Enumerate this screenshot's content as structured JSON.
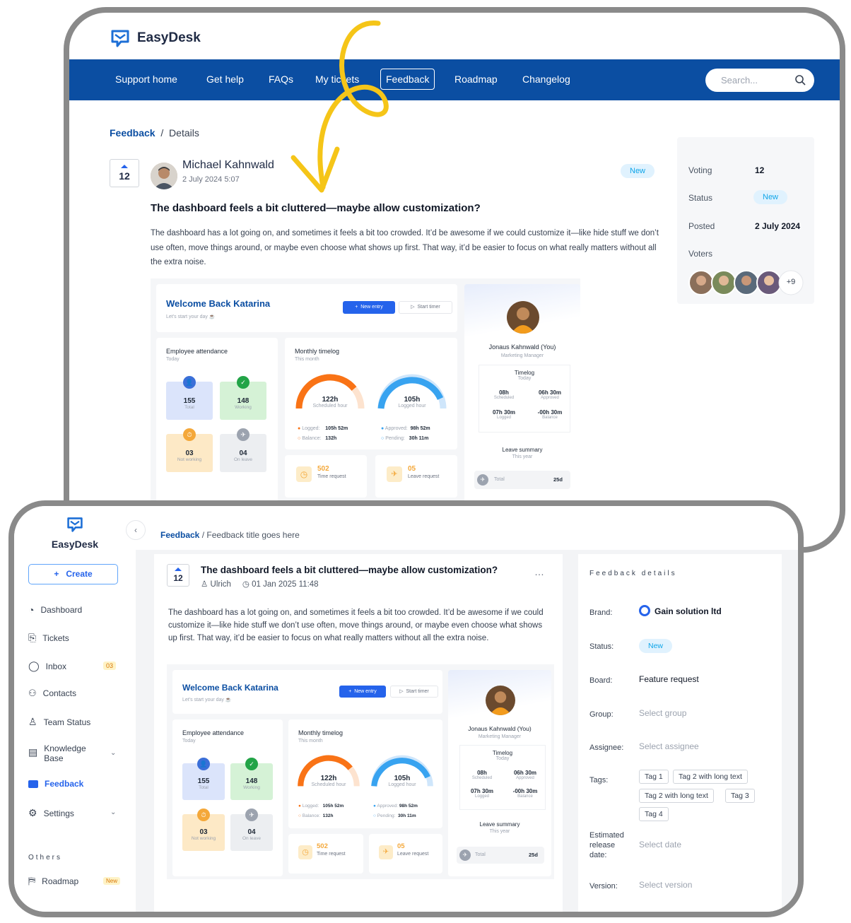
{
  "back": {
    "app_name": "EasyDesk",
    "nav": [
      "Support home",
      "Get help",
      "FAQs",
      "My tickets",
      "Feedback",
      "Roadmap",
      "Changelog"
    ],
    "search_placeholder": "Search...",
    "breadcrumb": {
      "link": "Feedback",
      "sep": "/",
      "current": "Details"
    },
    "votes": "12",
    "author": "Michael Kahnwald",
    "date": "2 July 2024 5:07",
    "status_badge": "New",
    "title": "The dashboard feels a bit cluttered—maybe allow customization?",
    "body": "The dashboard has a lot going on, and sometimes it feels a bit too crowded. It’d be awesome if we could customize it—like hide stuff we don’t use often, move things around, or maybe even choose what shows up first. That way, it’d be easier to focus on what really matters without all the extra noise.",
    "side": {
      "voting_label": "Voting",
      "voting_value": "12",
      "status_label": "Status",
      "status_value": "New",
      "posted_label": "Posted",
      "posted_value": "2 July 2024",
      "voters_label": "Voters",
      "voters_more": "+9"
    }
  },
  "dashboard": {
    "welcome": "Welcome Back Katarina",
    "welcome_sub": "Let's start your day",
    "new_entry": "New entry",
    "start_timer": "Start timer",
    "attendance_title": "Employee attendance",
    "attendance_sub": "Today",
    "tiles": [
      {
        "num": "155",
        "sub": "Total"
      },
      {
        "num": "148",
        "sub": "Working"
      },
      {
        "num": "03",
        "sub": "Not working"
      },
      {
        "num": "04",
        "sub": "On leave"
      }
    ],
    "timelog_title": "Monthly timelog",
    "timelog_sub": "This month",
    "gauge1": {
      "value": "122h",
      "sub": "Scheduled hour"
    },
    "gauge2": {
      "value": "105h",
      "sub": "Logged hour"
    },
    "legend": {
      "logged_label": "Logged:",
      "logged_value": "105h 52m",
      "balance_label": "Balance:",
      "balance_value": "132h",
      "approved_label": "Approved:",
      "approved_value": "98h 52m",
      "pending_label": "Pending:",
      "pending_value": "30h 11m"
    },
    "stat1": {
      "num": "502",
      "sub": "Time request"
    },
    "stat2": {
      "num": "05",
      "sub": "Leave request"
    },
    "profile": {
      "name": "Jonaus Kahnwald (You)",
      "role": "Marketing Manager"
    },
    "timelog_card": {
      "title": "Timelog",
      "sub": "Today",
      "a_val": "08h",
      "a_sub": "Scheduled",
      "b_val": "06h 30m",
      "b_sub": "Approved",
      "c_val": "07h 30m",
      "c_sub": "Logged",
      "d_val": "-00h 30m",
      "d_sub": "Balance"
    },
    "leave_title": "Leave summary",
    "leave_sub": "This year",
    "total_label": "Total",
    "total_value": "25d"
  },
  "front": {
    "app_name": "EasyDesk",
    "create_label": "Create",
    "sidebar": [
      {
        "label": "Dashboard"
      },
      {
        "label": "Tickets"
      },
      {
        "label": "Inbox",
        "count": "03"
      },
      {
        "label": "Contacts"
      },
      {
        "label": "Team Status"
      },
      {
        "label": "Knowledge Base"
      },
      {
        "label": "Feedback"
      },
      {
        "label": "Settings"
      }
    ],
    "others_label": "Others",
    "roadmap_label": "Roadmap",
    "roadmap_badge": "New",
    "breadcrumb": {
      "link": "Feedback",
      "sep": "/",
      "current": "Feedback title goes here"
    },
    "votes": "12",
    "title": "The dashboard feels a bit cluttered—maybe allow customization?",
    "user": "Ulrich",
    "date": "01 Jan 2025 11:48",
    "more": "…",
    "body": "The dashboard has a lot going on, and sometimes it feels a bit too crowded. It’d be awesome if we could customize it—like hide stuff we don’t use often, move things around, or maybe even choose what shows up first. That way, it’d be easier to focus on what really matters without all the extra noise.",
    "details": {
      "header": "Feedback details",
      "brand_label": "Brand:",
      "brand_value": "Gain solution ltd",
      "status_label": "Status:",
      "status_value": "New",
      "board_label": "Board:",
      "board_value": "Feature request",
      "group_label": "Group:",
      "group_ph": "Select group",
      "assignee_label": "Assignee:",
      "assignee_ph": "Select assignee",
      "tags_label": "Tags:",
      "tags": [
        "Tag 1",
        "Tag 2 with long text",
        "Tag 2 with long text",
        "Tag 3",
        "Tag 4"
      ],
      "release_label": "Estimated release date:",
      "release_ph": "Select date",
      "version_label": "Version:",
      "version_ph": "Select version"
    }
  },
  "colors": {
    "brand_blue": "#0b4ea2",
    "accent_yellow": "#f5c518",
    "badge_blue": "#0ea5e9"
  }
}
